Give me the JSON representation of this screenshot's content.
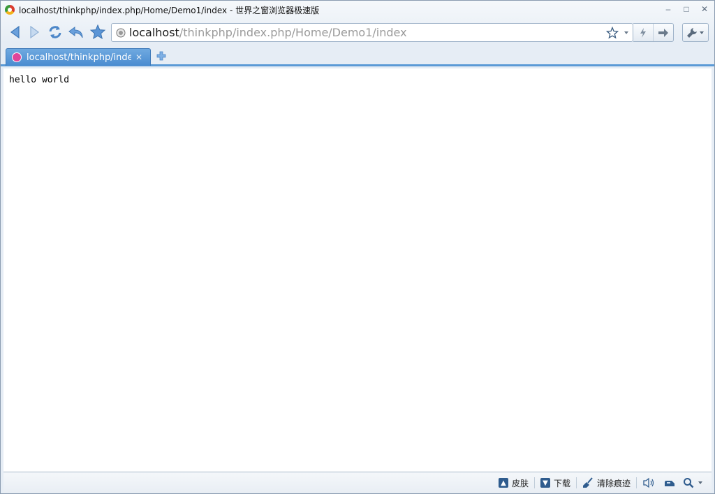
{
  "window": {
    "title": "localhost/thinkphp/index.php/Home/Demo1/index - 世界之窗浏览器极速版",
    "controls": {
      "minimize": "–",
      "maximize": "□",
      "close": "✕"
    }
  },
  "toolbar": {
    "address": {
      "host": "localhost",
      "path": "/thinkphp/index.php/Home/Demo1/index"
    }
  },
  "tabs": [
    {
      "title": "localhost/thinkphp/index.p",
      "close": "✕",
      "active": true
    }
  ],
  "page": {
    "body_text": "hello world"
  },
  "statusbar": {
    "skin_label": "皮肤",
    "download_label": "下载",
    "clear_traces_label": "清除痕迹"
  },
  "colors": {
    "accent": "#4a8cd0",
    "tab_underline": "#5b9ad6",
    "icon_blue": "#4b86c8"
  }
}
